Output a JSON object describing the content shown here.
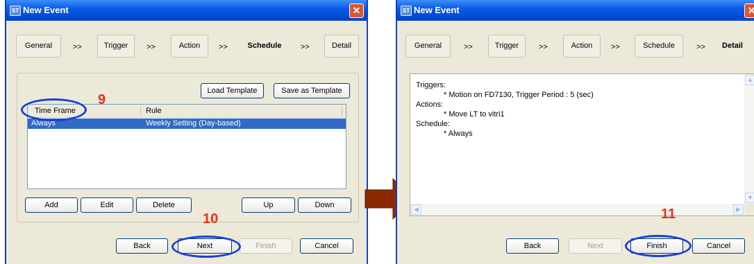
{
  "left_window": {
    "title": "New Event",
    "close_glyph": "✕",
    "steps": [
      "General",
      "Trigger",
      "Action",
      "Schedule",
      "Detail"
    ],
    "step_arrow": ">>",
    "active_step": "Schedule",
    "load_template": "Load Template",
    "save_template": "Save as Template",
    "columns": [
      "Time Frame",
      "Rule"
    ],
    "rows": [
      {
        "time_frame": "Always",
        "rule": "Weekly Setting (Day-based)"
      }
    ],
    "list_buttons": {
      "add": "Add",
      "edit": "Edit",
      "delete": "Delete",
      "up": "Up",
      "down": "Down"
    },
    "footer": {
      "back": "Back",
      "next": "Next",
      "finish": "Finish",
      "cancel": "Cancel"
    }
  },
  "right_window": {
    "title": "New Event",
    "steps": [
      "General",
      "Trigger",
      "Action",
      "Schedule",
      "Detail"
    ],
    "step_arrow": ">>",
    "active_step": "Detail",
    "summary": {
      "triggers_label": "Triggers:",
      "trigger_item": "* Motion on FD7130, Trigger Period : 5 (sec)",
      "actions_label": "Actions:",
      "action_item": "* Move LT to vitri1",
      "schedule_label": "Schedule:",
      "schedule_item": "* Always"
    },
    "footer": {
      "back": "Back",
      "next": "Next",
      "finish": "Finish",
      "cancel": "Cancel"
    }
  },
  "annotations": {
    "step_9": "9",
    "step_10": "10",
    "step_11": "11"
  },
  "colors": {
    "title_bar": "#0a5ce8",
    "selection": "#316ac5",
    "highlight_ellipse": "#1b3fd6",
    "annotation_number": "#e8301a",
    "connector_arrow": "#8b2a00"
  }
}
